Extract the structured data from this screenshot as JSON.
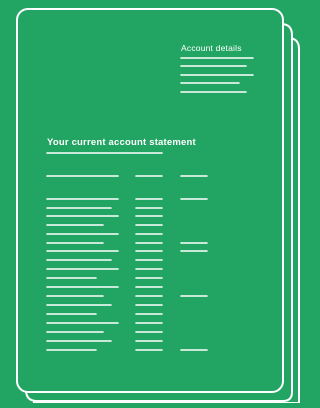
{
  "document": {
    "account_details_label": "Account details",
    "statement_title": "Your current account statement"
  },
  "colors": {
    "background": "#22a563",
    "foreground": "#ffffff"
  }
}
